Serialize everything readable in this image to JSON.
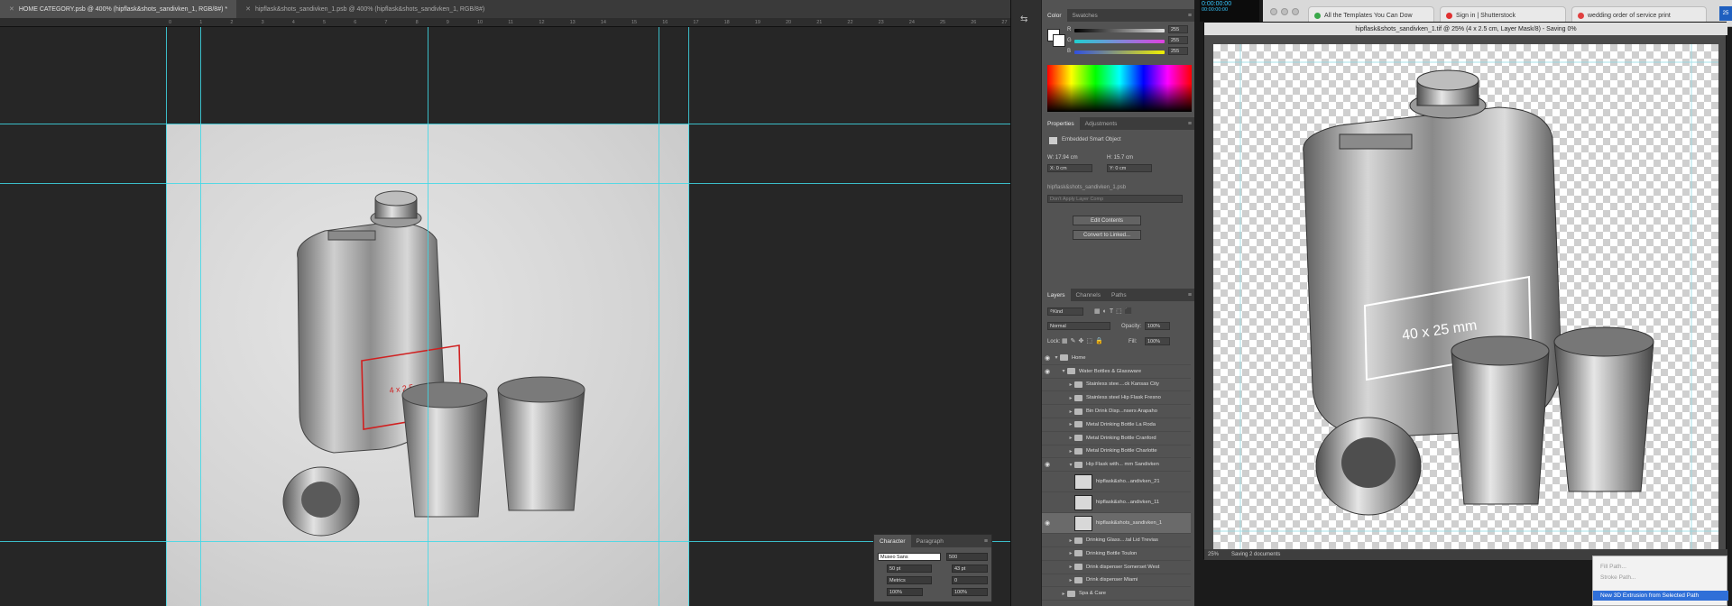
{
  "main": {
    "tabs": [
      {
        "label": "HOME CATEGORY.psb @ 400% (hipflask&shots_sandivken_1, RGB/8#) *",
        "active": true
      },
      {
        "label": "hipflask&shots_sandivken_1.psb @ 400% (hipflask&shots_sandivken_1, RGB/8#)",
        "active": false
      }
    ],
    "ruler_ticks": [
      "0",
      "1",
      "2",
      "3",
      "4",
      "5",
      "6",
      "7",
      "8",
      "9",
      "10",
      "11",
      "12",
      "13",
      "14",
      "15",
      "16",
      "17",
      "18",
      "19",
      "20",
      "21",
      "22",
      "23",
      "24",
      "25",
      "26",
      "27"
    ],
    "canvas_annotation": "4 x 2.5 cm"
  },
  "character_panel": {
    "tabs": [
      "Character",
      "Paragraph"
    ],
    "font_family": "Museo Sans",
    "font_style": "500",
    "font_size": "50 pt",
    "leading": "43 pt",
    "kerning": "Metrics",
    "tracking": "0",
    "vertical_scale": "100%",
    "horizontal_scale": "100%"
  },
  "color_panel": {
    "tabs": [
      "Color",
      "Swatches"
    ],
    "rgb": [
      {
        "label": "R",
        "value": "255",
        "color": "#e0e0e0"
      },
      {
        "label": "G",
        "value": "255",
        "color": "#e040e0"
      },
      {
        "label": "B",
        "value": "255",
        "color": "#f0f000"
      }
    ]
  },
  "properties_panel": {
    "tabs": [
      "Properties",
      "Adjustments"
    ],
    "type": "Embedded Smart Object",
    "w": "W: 17.94 cm",
    "h": "H: 15.7 cm",
    "x": "X: 0 cm",
    "y": "Y: 0 cm",
    "file": "hipflask&shots_sandivken_1.psb",
    "comp_placeholder": "Don't Apply Layer Comp",
    "edit_button": "Edit Contents",
    "convert_button": "Convert to Linked..."
  },
  "layers_panel": {
    "tabs": [
      "Layers",
      "Channels",
      "Paths"
    ],
    "filter": "Kind",
    "blend_mode": "Normal",
    "opacity_label": "Opacity:",
    "opacity": "100%",
    "lock_label": "Lock:",
    "fill_label": "Fill:",
    "fill": "100%",
    "layers": [
      {
        "name": "Home",
        "indent": 0,
        "eye": true,
        "expanded": true,
        "kind": "folder"
      },
      {
        "name": "Water Bottles & Glassware",
        "indent": 1,
        "eye": true,
        "expanded": true,
        "kind": "folder"
      },
      {
        "name": "Stainless stee....ck Kansas City",
        "indent": 2,
        "eye": false,
        "expanded": false,
        "kind": "folder"
      },
      {
        "name": "Stainless steel Hip Flask Fresno",
        "indent": 2,
        "eye": false,
        "expanded": false,
        "kind": "folder"
      },
      {
        "name": "Bin Drink Disp...nsers Arapaho",
        "indent": 2,
        "eye": false,
        "expanded": false,
        "kind": "folder"
      },
      {
        "name": "Metal Drinking Bottle La Roda",
        "indent": 2,
        "eye": false,
        "expanded": false,
        "kind": "folder"
      },
      {
        "name": "Metal Drinking Bottle Cranford",
        "indent": 2,
        "eye": false,
        "expanded": false,
        "kind": "folder"
      },
      {
        "name": "Metal Drinking Bottle Charlotte",
        "indent": 2,
        "eye": false,
        "expanded": false,
        "kind": "folder"
      },
      {
        "name": "Hip Flask with... mm Sandivken",
        "indent": 2,
        "eye": true,
        "expanded": true,
        "kind": "folder"
      },
      {
        "name": "hipflask&sho...andivken_21",
        "indent": 3,
        "eye": false,
        "expanded": false,
        "kind": "thumb"
      },
      {
        "name": "hipflask&sho...andivken_11",
        "indent": 3,
        "eye": false,
        "expanded": false,
        "kind": "thumb"
      },
      {
        "name": "hipflask&shots_sandivken_1",
        "indent": 3,
        "eye": true,
        "expanded": false,
        "kind": "thumb",
        "selected": true
      },
      {
        "name": "Drinking Glass....tal Lid Trevias",
        "indent": 2,
        "eye": false,
        "expanded": false,
        "kind": "folder"
      },
      {
        "name": "Drinking Bottle Toulon",
        "indent": 2,
        "eye": false,
        "expanded": false,
        "kind": "folder"
      },
      {
        "name": "Drink dispenser Somerset West",
        "indent": 2,
        "eye": false,
        "expanded": false,
        "kind": "folder"
      },
      {
        "name": "Drink dispenser Miami",
        "indent": 2,
        "eye": false,
        "expanded": false,
        "kind": "folder"
      },
      {
        "name": "Spa & Care",
        "indent": 1,
        "eye": false,
        "expanded": false,
        "kind": "folder"
      }
    ]
  },
  "timer": {
    "line1": "0:00:00:00",
    "line2": "00:00:00:00"
  },
  "browser": {
    "tabs": [
      {
        "label": "All the Templates You Can Dow",
        "color": "#3aa84a"
      },
      {
        "label": "Sign in | Shutterstock",
        "color": "#e03030"
      },
      {
        "label": "wedding order of service print",
        "color": "#e04040"
      }
    ]
  },
  "image_window": {
    "title": "hipflask&shots_sandivken_1.tif @ 25% (4 x 2.5 cm, Layer Mask/8) - Saving 0%",
    "canvas_annotation": "40 x 25 mm",
    "zoom": "25%",
    "status": "Saving 2 documents"
  },
  "context_menu": {
    "items": [
      {
        "label": "Fill Path...",
        "active": false
      },
      {
        "label": "Stroke Path...",
        "active": false
      },
      {
        "label": "New 3D Extrusion from Selected Path",
        "active": true
      }
    ]
  },
  "badge": "25"
}
